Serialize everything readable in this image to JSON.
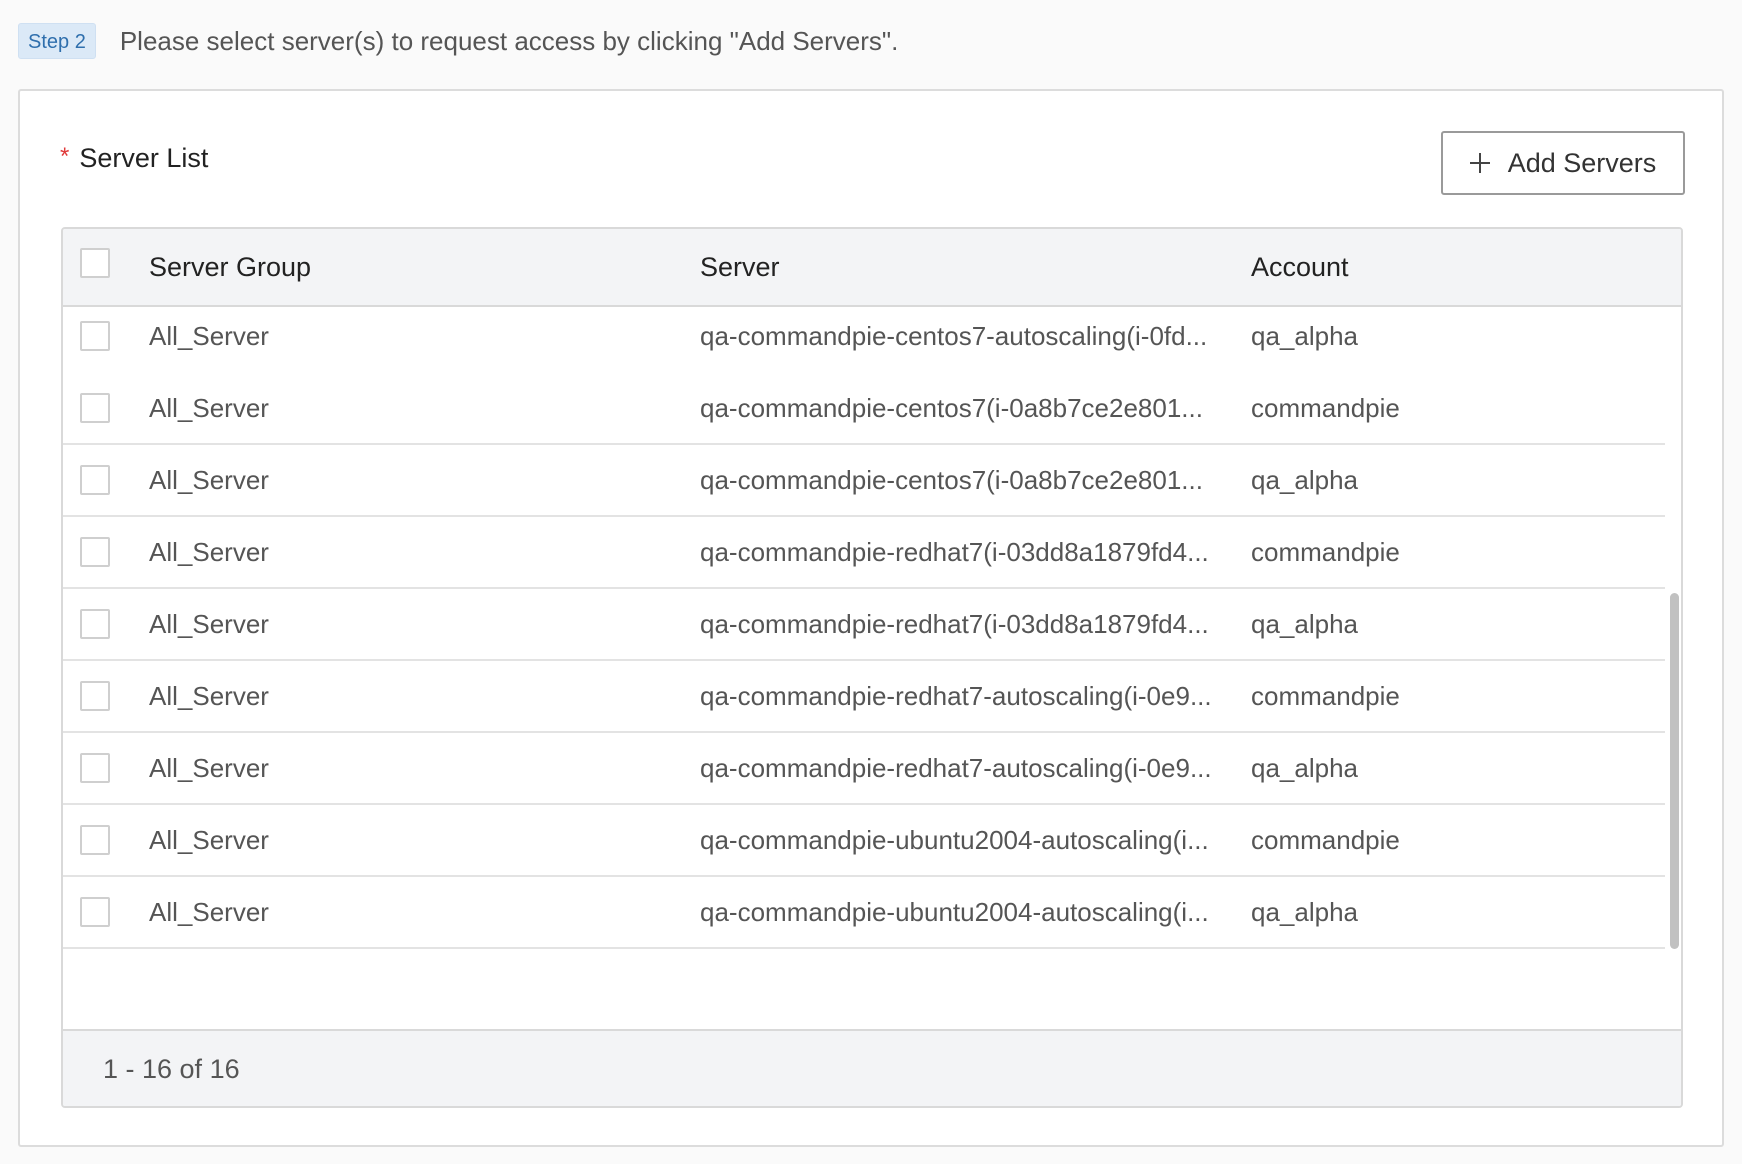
{
  "step": {
    "badge": "Step 2",
    "instruction": "Please select server(s) to request access by clicking \"Add Servers\"."
  },
  "server_list": {
    "required_marker": "*",
    "title": "Server List",
    "add_button_label": "Add Servers",
    "columns": [
      "Server Group",
      "Server",
      "Account"
    ],
    "rows": [
      {
        "group": "All_Server",
        "server": "qa-commandpie-centos7-autoscaling(i-0fd...",
        "account": "qa_alpha"
      },
      {
        "group": "All_Server",
        "server": "qa-commandpie-centos7(i-0a8b7ce2e801...",
        "account": "commandpie"
      },
      {
        "group": "All_Server",
        "server": "qa-commandpie-centos7(i-0a8b7ce2e801...",
        "account": "qa_alpha"
      },
      {
        "group": "All_Server",
        "server": "qa-commandpie-redhat7(i-03dd8a1879fd4...",
        "account": "commandpie"
      },
      {
        "group": "All_Server",
        "server": "qa-commandpie-redhat7(i-03dd8a1879fd4...",
        "account": "qa_alpha"
      },
      {
        "group": "All_Server",
        "server": "qa-commandpie-redhat7-autoscaling(i-0e9...",
        "account": "commandpie"
      },
      {
        "group": "All_Server",
        "server": "qa-commandpie-redhat7-autoscaling(i-0e9...",
        "account": "qa_alpha"
      },
      {
        "group": "All_Server",
        "server": "qa-commandpie-ubuntu2004-autoscaling(i...",
        "account": "commandpie"
      },
      {
        "group": "All_Server",
        "server": "qa-commandpie-ubuntu2004-autoscaling(i...",
        "account": "qa_alpha"
      }
    ],
    "pagination": "1 - 16 of 16",
    "scroll_position": 0.4
  },
  "colors": {
    "required": "#e03a3a",
    "badge_bg": "#dbe9f7",
    "badge_text": "#2f6fad",
    "header_bg": "#f3f4f6"
  }
}
